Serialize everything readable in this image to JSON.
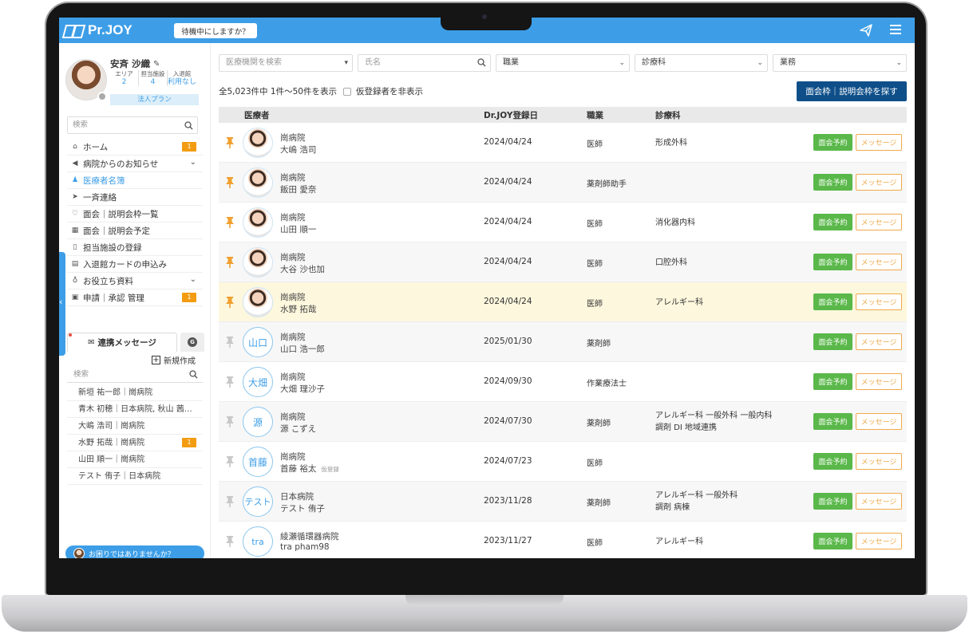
{
  "app": {
    "logo": "Pr.JOY",
    "standby_button": "待機中にしますか？"
  },
  "user": {
    "name": "安斉 沙織",
    "stats": [
      {
        "label": "エリア",
        "value": "2"
      },
      {
        "label": "担当施設",
        "value": "4"
      },
      {
        "label": "入退館",
        "value": "利用なし"
      }
    ],
    "plan": "法人プラン"
  },
  "sidebar": {
    "search_placeholder": "検索",
    "items": [
      {
        "label": "ホーム",
        "icon": "home-icon",
        "badge": "1"
      },
      {
        "label": "病院からのお知らせ",
        "icon": "megaphone-icon",
        "chevron": true
      },
      {
        "label": "医療者名簿",
        "icon": "doctor-icon",
        "active": true
      },
      {
        "label": "一斉連絡",
        "icon": "paper-plane-icon"
      },
      {
        "label": "面会｜説明会枠一覧",
        "icon": "handshake-icon"
      },
      {
        "label": "面会｜説明会予定",
        "icon": "calendar-icon"
      },
      {
        "label": "担当施設の登録",
        "icon": "clipboard-icon"
      },
      {
        "label": "入退館カードの申込み",
        "icon": "id-card-icon"
      },
      {
        "label": "お役立ち資料",
        "icon": "lightbulb-icon",
        "chevron": true
      },
      {
        "label": "申請｜承認 管理",
        "icon": "document-icon",
        "badge": "1"
      }
    ],
    "message_tab": "連携メッセージ",
    "g_tab": "G",
    "new_create": "新規作成",
    "message_search_placeholder": "検索",
    "contacts": [
      {
        "label": "新垣 祐一郎｜崗病院"
      },
      {
        "label": "青木 初穂｜日本病院, 秋山 茜…"
      },
      {
        "label": "大嶋 浩司｜崗病院"
      },
      {
        "label": "水野 拓哉｜崗病院",
        "badge": "1"
      },
      {
        "label": "山田 順一｜崗病院"
      },
      {
        "label": "テスト 侑子｜日本病院"
      }
    ],
    "help": "お困りではありませんか？"
  },
  "filters": {
    "institution_placeholder": "医療機関を検索",
    "name_placeholder": "氏名",
    "job_label": "職業",
    "dept_label": "診療科",
    "work_label": "業務"
  },
  "list": {
    "count_text": "全5,023件中 1件〜50件を表示",
    "hide_provisional": "仮登録者を非表示",
    "search_button": "面会枠｜説明会枠を探す",
    "headers": {
      "person": "医療者",
      "date": "Dr.JOY登録日",
      "job": "職業",
      "dept": "診療科"
    },
    "meet_label": "面会予約",
    "msg_label": "メッセージ",
    "rows": [
      {
        "pinned": true,
        "avatar": "photo",
        "hospital": "崗病院",
        "name": "大嶋 浩司",
        "date": "2024/04/24",
        "job": "医師",
        "dept": [
          "形成外科"
        ]
      },
      {
        "pinned": true,
        "avatar": "photo",
        "hospital": "崗病院",
        "name": "飯田 愛奈",
        "date": "2024/04/24",
        "job": "薬剤師助手",
        "dept": []
      },
      {
        "pinned": true,
        "avatar": "photo",
        "hospital": "崗病院",
        "name": "山田 順一",
        "date": "2024/04/24",
        "job": "医師",
        "dept": [
          "消化器内科"
        ]
      },
      {
        "pinned": true,
        "avatar": "photo",
        "hospital": "崗病院",
        "name": "大谷 沙也加",
        "date": "2024/04/24",
        "job": "医師",
        "dept": [
          "口腔外科"
        ]
      },
      {
        "pinned": true,
        "avatar": "photo",
        "hospital": "崗病院",
        "name": "水野 拓哉",
        "date": "2024/04/24",
        "job": "医師",
        "dept": [
          "アレルギー科"
        ],
        "highlight": true
      },
      {
        "pinned": false,
        "avatar": "山口",
        "hospital": "崗病院",
        "name": "山口 浩一郎",
        "date": "2025/01/30",
        "job": "薬剤師",
        "dept": []
      },
      {
        "pinned": false,
        "avatar": "大畑",
        "hospital": "崗病院",
        "name": "大畑 理沙子",
        "date": "2024/09/30",
        "job": "作業療法士",
        "dept": []
      },
      {
        "pinned": false,
        "avatar": "源",
        "hospital": "崗病院",
        "name": "源 こずえ",
        "date": "2024/07/30",
        "job": "薬剤師",
        "dept": [
          "アレルギー科 一般外科 一般内科",
          "調剤 DI 地域連携"
        ]
      },
      {
        "pinned": false,
        "avatar": "首藤",
        "hospital": "崗病院",
        "name": "首藤 裕太",
        "provisional": "仮登録",
        "date": "2024/07/23",
        "job": "医師",
        "dept": []
      },
      {
        "pinned": false,
        "avatar": "テスト",
        "hospital": "日本病院",
        "name": "テスト 侑子",
        "date": "2023/11/28",
        "job": "薬剤師",
        "dept": [
          "アレルギー科 一般外科",
          "調剤 病棟"
        ]
      },
      {
        "pinned": false,
        "avatar": "tra",
        "hospital": "綾瀬循環器病院",
        "name": "tra pham98",
        "date": "2023/11/27",
        "job": "医師",
        "dept": [
          "アレルギー科"
        ]
      }
    ]
  },
  "colors": {
    "brand": "#3d9ee7",
    "primary_button": "#0f4f89",
    "meet_button": "#5ab84a",
    "message_button": "#f0a94c",
    "badge": "#f39c12",
    "pin_active": "#f0a030",
    "pin_inactive": "#c8c8c8"
  }
}
